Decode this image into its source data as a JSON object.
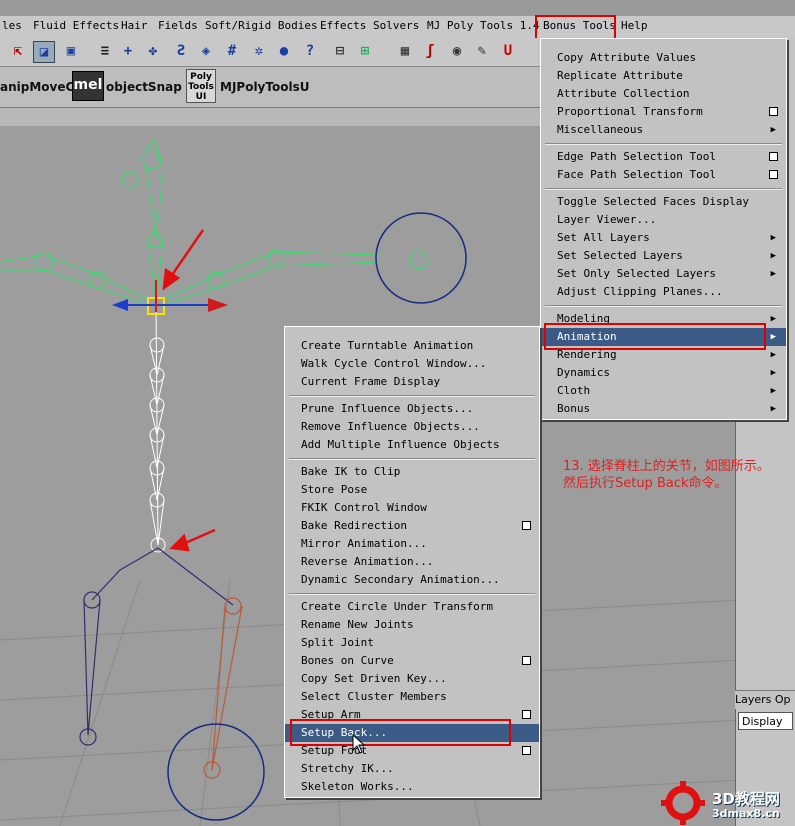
{
  "menubar": {
    "items": [
      "les",
      "Fluid Effects",
      "Hair",
      "Fields",
      "Soft/Rigid Bodies",
      "Effects",
      "Solvers",
      "MJ Poly Tools 1.4",
      "Bonus Tools",
      "Help"
    ]
  },
  "shelf": {
    "tool1": "anipMoveCo",
    "mel": "mel",
    "tool2": "objectSnap",
    "poly_icon": "Poly Tools UI",
    "tool3": "MJPolyToolsU"
  },
  "bonus_menu": {
    "items": [
      {
        "label": "Copy Attribute Values"
      },
      {
        "label": "Replicate Attribute"
      },
      {
        "label": "Attribute Collection"
      },
      {
        "label": "Proportional Transform",
        "option_box": true
      },
      {
        "label": "Miscellaneous",
        "submenu": true
      },
      {
        "label": "Edge Path Selection Tool",
        "option_box": true
      },
      {
        "label": "Face Path Selection Tool",
        "option_box": true
      },
      {
        "label": "Toggle Selected Faces Display"
      },
      {
        "label": "Layer Viewer..."
      },
      {
        "label": "Set All Layers",
        "submenu": true
      },
      {
        "label": "Set Selected Layers",
        "submenu": true
      },
      {
        "label": "Set Only Selected Layers",
        "submenu": true
      },
      {
        "label": "Adjust Clipping Planes..."
      },
      {
        "label": "Modeling",
        "submenu": true
      },
      {
        "label": "Animation",
        "submenu": true,
        "highlighted": true
      },
      {
        "label": "Rendering",
        "submenu": true
      },
      {
        "label": "Dynamics",
        "submenu": true
      },
      {
        "label": "Cloth",
        "submenu": true
      },
      {
        "label": "Bonus",
        "submenu": true
      }
    ]
  },
  "animation_submenu": {
    "items": [
      {
        "label": "Create Turntable Animation"
      },
      {
        "label": "Walk Cycle Control Window..."
      },
      {
        "label": "Current Frame Display"
      },
      {
        "label": "Prune Influence Objects..."
      },
      {
        "label": "Remove Influence Objects..."
      },
      {
        "label": "Add Multiple Influence Objects"
      },
      {
        "label": "Bake IK to Clip"
      },
      {
        "label": "Store Pose"
      },
      {
        "label": "FKIK Control Window"
      },
      {
        "label": "Bake Redirection",
        "option_box": true
      },
      {
        "label": "Mirror Animation..."
      },
      {
        "label": "Reverse Animation..."
      },
      {
        "label": "Dynamic Secondary Animation..."
      },
      {
        "label": "Create Circle Under Transform"
      },
      {
        "label": "Rename New Joints"
      },
      {
        "label": "Split Joint"
      },
      {
        "label": "Bones on Curve",
        "option_box": true
      },
      {
        "label": "Copy Set Driven Key..."
      },
      {
        "label": "Select Cluster Members"
      },
      {
        "label": "Setup Arm",
        "option_box": true
      },
      {
        "label": "Setup Back...",
        "highlighted": true
      },
      {
        "label": "Setup Foot",
        "option_box": true
      },
      {
        "label": "Stretchy IK..."
      },
      {
        "label": "Skeleton Works..."
      }
    ]
  },
  "annotation": "13. 选择脊柱上的关节，如图所示。然后执行Setup Back命令。",
  "layers": {
    "header": "Layers  Op",
    "display": "Display"
  },
  "watermark": {
    "line1": "3D教程网",
    "line2": "3dmax8.cn"
  },
  "colors": {
    "highlight": "#3b5a86",
    "annotation": "#e02020",
    "joint": "#2ee06a",
    "skeleton_leg": "#3a2a6a"
  }
}
